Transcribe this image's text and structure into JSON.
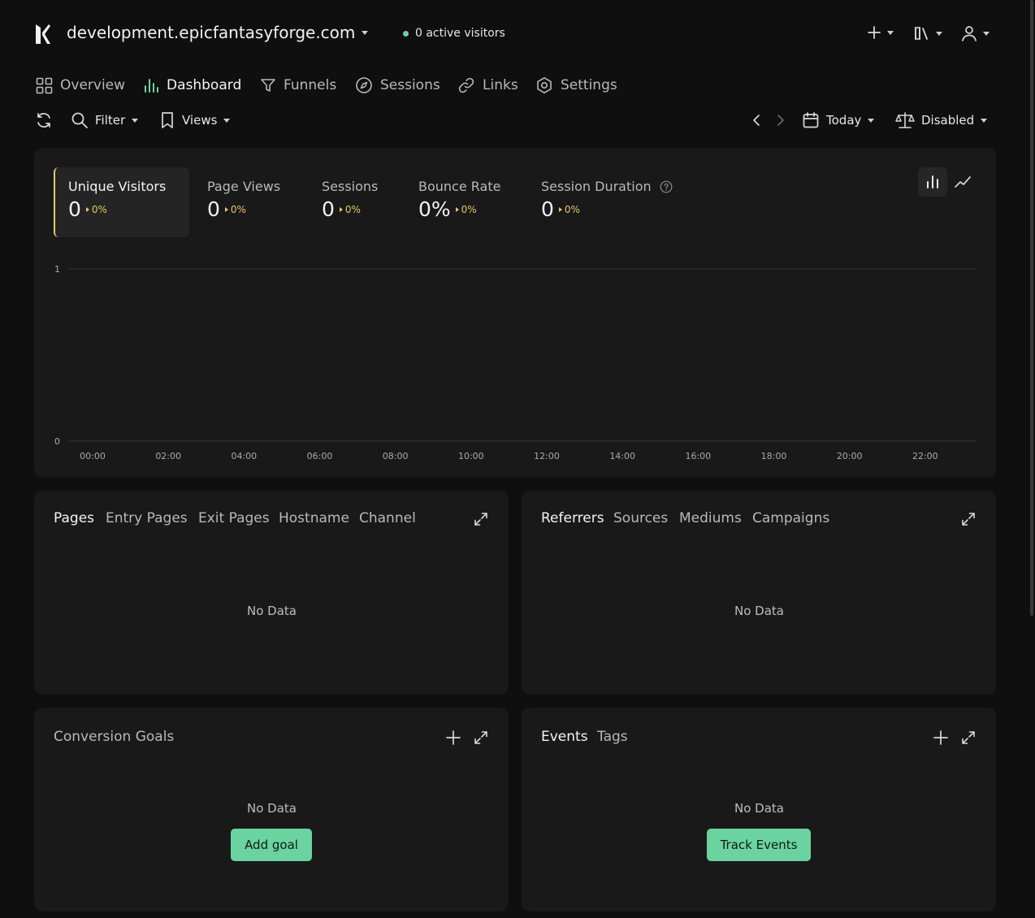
{
  "header": {
    "site": "development.epicfantasyforge.com",
    "active_visitors": "0 active visitors"
  },
  "nav": [
    {
      "label": "Overview",
      "icon": "grid-icon"
    },
    {
      "label": "Dashboard",
      "icon": "bar-chart-icon"
    },
    {
      "label": "Funnels",
      "icon": "funnel-icon"
    },
    {
      "label": "Sessions",
      "icon": "compass-icon"
    },
    {
      "label": "Links",
      "icon": "link-icon"
    },
    {
      "label": "Settings",
      "icon": "settings-icon"
    }
  ],
  "toolbar": {
    "filter": "Filter",
    "views": "Views",
    "date": "Today",
    "compare": "Disabled"
  },
  "metrics": [
    {
      "label": "Unique Visitors",
      "value": "0",
      "change": "0%"
    },
    {
      "label": "Page Views",
      "value": "0",
      "change": "0%"
    },
    {
      "label": "Sessions",
      "value": "0",
      "change": "0%"
    },
    {
      "label": "Bounce Rate",
      "value": "0%",
      "change": "0%"
    },
    {
      "label": "Session Duration",
      "value": "0",
      "change": "0%"
    }
  ],
  "chart_data": {
    "type": "bar",
    "categories": [
      "00:00",
      "02:00",
      "04:00",
      "06:00",
      "08:00",
      "10:00",
      "12:00",
      "14:00",
      "16:00",
      "18:00",
      "20:00",
      "22:00"
    ],
    "values": [
      0,
      0,
      0,
      0,
      0,
      0,
      0,
      0,
      0,
      0,
      0,
      0
    ],
    "ylim": [
      0,
      1
    ],
    "yticks": [
      "0",
      "1"
    ],
    "grid": true
  },
  "pages_card": {
    "tabs": [
      "Pages",
      "Entry Pages",
      "Exit Pages",
      "Hostname",
      "Channel"
    ],
    "empty": "No Data"
  },
  "referrers_card": {
    "tabs": [
      "Referrers",
      "Sources",
      "Mediums",
      "Campaigns"
    ],
    "empty": "No Data"
  },
  "goals_card": {
    "title": "Conversion Goals",
    "empty": "No Data",
    "button": "Add goal"
  },
  "events_card": {
    "tabs": [
      "Events",
      "Tags"
    ],
    "empty": "No Data",
    "button": "Track Events"
  },
  "colors": {
    "background": "#0f0f0f",
    "card": "#191919",
    "accent_green": "#6bd3a0",
    "accent_yellow": "#e5c76b"
  }
}
